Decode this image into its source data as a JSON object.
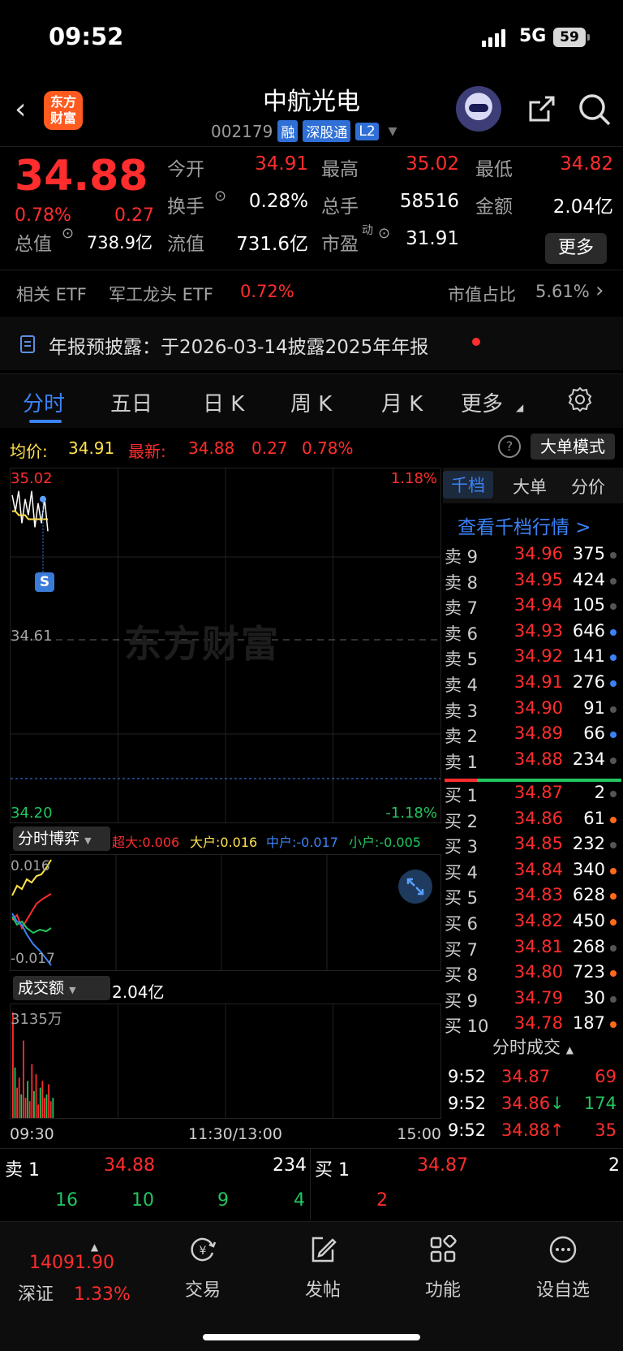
{
  "status": {
    "time": "09:52",
    "network": "5G",
    "battery": "59"
  },
  "header": {
    "logo": "东方\n财富",
    "stock_name": "中航光电",
    "code": "002179",
    "tags": [
      "融",
      "深股通",
      "L2"
    ]
  },
  "quote": {
    "price": "34.88",
    "pct": "0.78%",
    "change": "0.27",
    "fields": [
      {
        "label": "今开",
        "value": "34.91",
        "color": "red"
      },
      {
        "label": "最高",
        "value": "35.02",
        "color": "red"
      },
      {
        "label": "最低",
        "value": "34.82",
        "color": "red"
      },
      {
        "label": "换手",
        "value": "0.28%",
        "color": "white"
      },
      {
        "label": "总手",
        "value": "58516",
        "color": "white"
      },
      {
        "label": "金额",
        "value": "2.04亿",
        "color": "white"
      },
      {
        "label": "总值",
        "value": "738.9亿",
        "color": "white"
      },
      {
        "label": "流值",
        "value": "731.6亿",
        "color": "white"
      },
      {
        "label": "市盈",
        "value": "31.91",
        "color": "white"
      }
    ],
    "pe_suffix": "动",
    "more_label": "更多"
  },
  "etf": {
    "label": "相关 ETF",
    "name": "军工龙头 ETF",
    "pct": "0.72%",
    "ratio_label": "市值占比",
    "ratio": "5.61%"
  },
  "notice": {
    "text": "年报预披露：于2026-03-14披露2025年年报"
  },
  "tabs": [
    "分时",
    "五日",
    "日 K",
    "周 K",
    "月 K",
    "更多"
  ],
  "avg": {
    "label": "均价:",
    "value": "34.91",
    "latest_label": "最新:",
    "latest": "34.88",
    "change": "0.27",
    "pct": "0.78%",
    "mode_label": "大单模式"
  },
  "chart": {
    "high": "35.02",
    "high_pct": "1.18%",
    "mid": "34.61",
    "low": "34.20",
    "low_pct": "-1.18%",
    "watermark": "东方财富",
    "badge": "S"
  },
  "chart_data": {
    "type": "line",
    "title": "",
    "ylim": [
      34.2,
      35.02
    ],
    "y_ref": 34.61,
    "series": [
      {
        "name": "最新",
        "values": [
          34.97,
          34.93,
          34.98,
          34.9,
          34.96,
          34.92,
          34.98,
          34.89,
          34.95,
          34.9,
          34.96,
          34.88
        ]
      },
      {
        "name": "均价",
        "values": [
          34.93,
          34.93,
          34.92,
          34.92,
          34.92,
          34.91,
          34.91,
          34.91,
          34.91,
          34.91,
          34.91,
          34.91
        ]
      }
    ],
    "volume_max": "3135万",
    "volume": [
      3135,
      1500,
      900,
      1200,
      700,
      2300,
      600,
      1100,
      500,
      1600,
      800,
      1300,
      400,
      900,
      1100,
      600,
      700,
      1000,
      500,
      600
    ]
  },
  "game": {
    "label": "分时博弈",
    "items": [
      {
        "text": "超大:0.006",
        "color": "red"
      },
      {
        "text": "大户:0.016",
        "color": "yellow"
      },
      {
        "text": "中户:-0.017",
        "color": "blue"
      },
      {
        "text": "小户:-0.005",
        "color": "green"
      }
    ],
    "top": "0.016",
    "bottom": "-0.017"
  },
  "volume": {
    "label": "成交额",
    "value": "2.04亿",
    "max": "3135万"
  },
  "time_axis": [
    "09:30",
    "11:30/13:00",
    "15:00"
  ],
  "book": {
    "tabs": [
      "千档",
      "大单",
      "分价"
    ],
    "view_label": "查看千档行情 >",
    "sell": [
      {
        "l": "卖 9",
        "p": "34.96",
        "v": "375",
        "dot": "gray"
      },
      {
        "l": "卖 8",
        "p": "34.95",
        "v": "424",
        "dot": "gray"
      },
      {
        "l": "卖 7",
        "p": "34.94",
        "v": "105",
        "dot": "gray"
      },
      {
        "l": "卖 6",
        "p": "34.93",
        "v": "646",
        "dot": "blue"
      },
      {
        "l": "卖 5",
        "p": "34.92",
        "v": "141",
        "dot": "blue"
      },
      {
        "l": "卖 4",
        "p": "34.91",
        "v": "276",
        "dot": "blue"
      },
      {
        "l": "卖 3",
        "p": "34.90",
        "v": "91",
        "dot": "gray"
      },
      {
        "l": "卖 2",
        "p": "34.89",
        "v": "66",
        "dot": "blue"
      },
      {
        "l": "卖 1",
        "p": "34.88",
        "v": "234",
        "dot": "gray"
      }
    ],
    "buy": [
      {
        "l": "买 1",
        "p": "34.87",
        "v": "2",
        "dot": "gray"
      },
      {
        "l": "买 2",
        "p": "34.86",
        "v": "61",
        "dot": "orange"
      },
      {
        "l": "买 3",
        "p": "34.85",
        "v": "232",
        "dot": "gray"
      },
      {
        "l": "买 4",
        "p": "34.84",
        "v": "340",
        "dot": "orange"
      },
      {
        "l": "买 5",
        "p": "34.83",
        "v": "628",
        "dot": "orange"
      },
      {
        "l": "买 6",
        "p": "34.82",
        "v": "450",
        "dot": "orange"
      },
      {
        "l": "买 7",
        "p": "34.81",
        "v": "268",
        "dot": "gray"
      },
      {
        "l": "买 8",
        "p": "34.80",
        "v": "723",
        "dot": "orange"
      },
      {
        "l": "买 9",
        "p": "34.79",
        "v": "30",
        "dot": "gray"
      },
      {
        "l": "买 10",
        "p": "34.78",
        "v": "187",
        "dot": "orange"
      }
    ],
    "trade_label": "分时成交",
    "trades": [
      {
        "t": "9:52",
        "p": "34.87",
        "arrow": "",
        "v": "69",
        "color": "red"
      },
      {
        "t": "9:52",
        "p": "34.86",
        "arrow": "↓",
        "v": "174",
        "color": "green"
      },
      {
        "t": "9:52",
        "p": "34.88",
        "arrow": "↑",
        "v": "35",
        "color": "red"
      }
    ]
  },
  "quick": {
    "sell_label": "卖 1",
    "sell_price": "34.88",
    "sell_vol": "234",
    "buy_label": "买 1",
    "buy_price": "34.87",
    "buy_vol": "2",
    "sell_queue": [
      "16",
      "10",
      "9",
      "4"
    ],
    "buy_queue": [
      "2"
    ]
  },
  "nav": {
    "index_value": "14091.90",
    "index_name": "深证",
    "index_pct": "1.33%",
    "items": [
      "交易",
      "发帖",
      "功能",
      "设自选"
    ]
  },
  "colors": {
    "up": "#ff2d2d",
    "down": "#22c55e",
    "accent": "#3b82f6",
    "avg": "#ffe14a"
  }
}
